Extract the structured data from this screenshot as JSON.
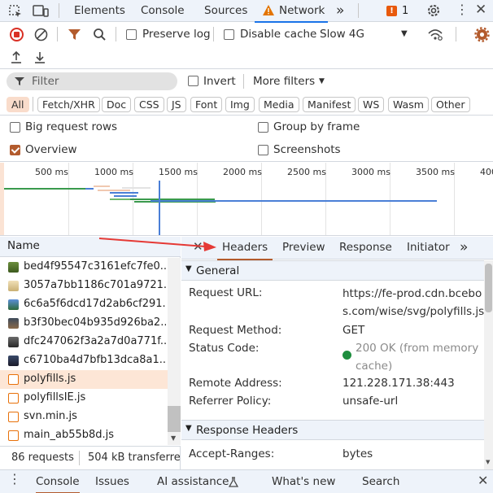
{
  "top_tabs": {
    "elements": "Elements",
    "console": "Console",
    "sources": "Sources",
    "network": "Network",
    "more_glyph": "»",
    "issues_count": "1"
  },
  "toolbar": {
    "preserve_log": "Preserve log",
    "disable_cache": "Disable cache",
    "throttling": "Slow 4G",
    "filter_placeholder": "Filter",
    "invert": "Invert",
    "more_filters": "More filters",
    "big_rows": "Big request rows",
    "group_by_frame": "Group by frame",
    "overview": "Overview",
    "screenshots": "Screenshots"
  },
  "type_chips": [
    "All",
    "Fetch/XHR",
    "Doc",
    "CSS",
    "JS",
    "Font",
    "Img",
    "Media",
    "Manifest",
    "WS",
    "Wasm",
    "Other"
  ],
  "timeline": {
    "ticks": [
      "500 ms",
      "1000 ms",
      "1500 ms",
      "2000 ms",
      "2500 ms",
      "3000 ms",
      "3500 ms",
      "400"
    ]
  },
  "list": {
    "header": "Name",
    "rows": [
      {
        "name": "bed4f95547c3161efc7fe0...",
        "icon": "image-icon"
      },
      {
        "name": "3057a7bb1186c701a9721...",
        "icon": "image-icon"
      },
      {
        "name": "6c6a5f6dcd17d2ab6cf291...",
        "icon": "image-icon"
      },
      {
        "name": "b3f30bec04b935d926ba2...",
        "icon": "image-icon"
      },
      {
        "name": "dfc247062f3a2a7d0a771f...",
        "icon": "image-icon"
      },
      {
        "name": "c6710ba4d7bfb13dca8a1...",
        "icon": "image-icon"
      },
      {
        "name": "polyfills.js",
        "icon": "script-icon"
      },
      {
        "name": "polyfillsIE.js",
        "icon": "script-icon"
      },
      {
        "name": "svn.min.js",
        "icon": "script-icon"
      },
      {
        "name": "main_ab55b8d.js",
        "icon": "script-icon"
      }
    ]
  },
  "status": {
    "requests": "86 requests",
    "transferred": "504 kB transferred"
  },
  "details": {
    "tabs": [
      "Headers",
      "Preview",
      "Response",
      "Initiator"
    ],
    "more_glyph": "»",
    "general_title": "General",
    "request_url_label": "Request URL:",
    "request_url_value": "https://fe-prod.cdn.bcebos.com/wise/svg/polyfills.js",
    "request_method_label": "Request Method:",
    "request_method_value": "GET",
    "status_code_label": "Status Code:",
    "status_code_value": "200 OK (from memory cache)",
    "remote_address_label": "Remote Address:",
    "remote_address_value": "121.228.171.38:443",
    "referrer_policy_label": "Referrer Policy:",
    "referrer_policy_value": "unsafe-url",
    "response_headers_title": "Response Headers",
    "accept_ranges_label": "Accept-Ranges:",
    "accept_ranges_value": "bytes"
  },
  "drawer": {
    "tabs": [
      "Console",
      "Issues",
      "AI assistance",
      "What's new",
      "Search"
    ]
  },
  "colors": {
    "accent": "#b35b2d",
    "selected_row": "#fde6d6",
    "status_ok": "#1e8e3e"
  }
}
